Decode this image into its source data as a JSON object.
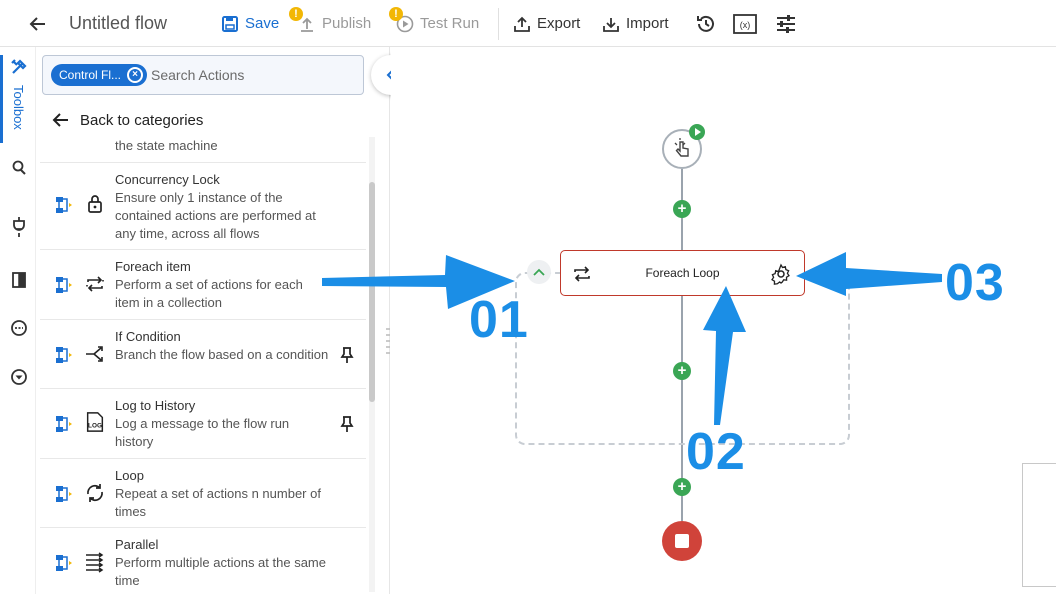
{
  "app": {
    "title": "Untitled flow"
  },
  "toolbar": {
    "save_label": "Save",
    "publish_label": "Publish",
    "test_run_label": "Test Run",
    "export_label": "Export",
    "import_label": "Import",
    "warning_symbol": "!"
  },
  "rail": {
    "toolbox_label": "Toolbox"
  },
  "search": {
    "chip_label": "Control Fl...",
    "chip_clear_symbol": "×",
    "placeholder": "Search Actions"
  },
  "panel": {
    "back_label": "Back to categories"
  },
  "actions": [
    {
      "title": "",
      "desc": "the state machine",
      "icon": "state-machine",
      "pinned": false
    },
    {
      "title": "Concurrency Lock",
      "desc": "Ensure only 1 instance of the contained actions are performed at any time, across all flows",
      "icon": "lock-icon",
      "pinned": false
    },
    {
      "title": "Foreach item",
      "desc": "Perform a set of actions for each item in a collection",
      "icon": "foreach-icon",
      "pinned": false
    },
    {
      "title": "If Condition",
      "desc": "Branch the flow based on a condition",
      "icon": "branch-icon",
      "pinned": true
    },
    {
      "title": "Log to History",
      "desc": "Log a message to the flow run history",
      "icon": "log-icon",
      "pinned": true
    },
    {
      "title": "Loop",
      "desc": "Repeat a set of actions n number of times",
      "icon": "loop-icon",
      "pinned": false
    },
    {
      "title": "Parallel",
      "desc": "Perform multiple actions at the same time",
      "icon": "parallel-icon",
      "pinned": false
    }
  ],
  "canvas": {
    "loop_node_title": "Foreach Loop",
    "plus_symbol": "+"
  },
  "annotations": {
    "a1": "01",
    "a2": "02",
    "a3": "03"
  },
  "colors": {
    "accent": "#1a6fd1",
    "annotation": "#1b8ee6",
    "add": "#3aa655",
    "end": "#d0433a",
    "node_border": "#c0392b"
  }
}
